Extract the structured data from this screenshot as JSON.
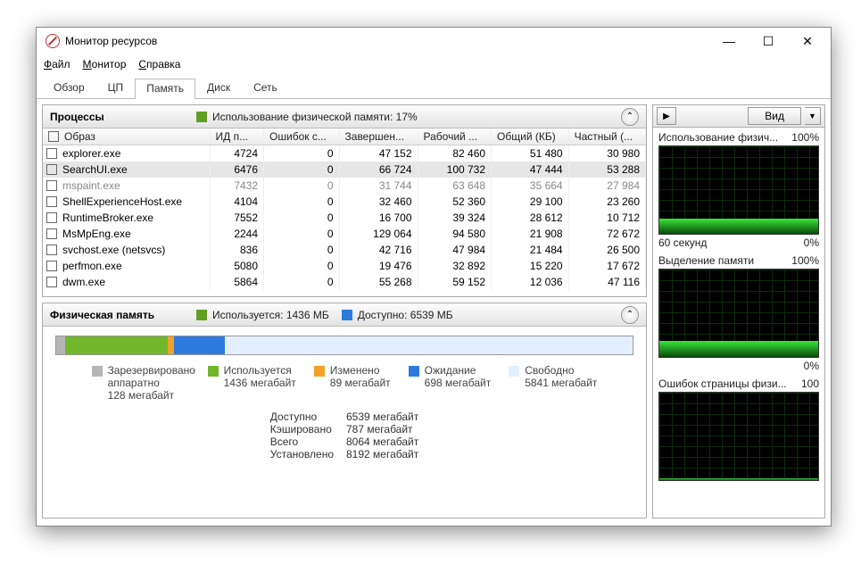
{
  "window": {
    "title": "Монитор ресурсов"
  },
  "menu": {
    "file": "Файл",
    "monitor": "Монитор",
    "help": "Справка"
  },
  "tabs": {
    "overview": "Обзор",
    "cpu": "ЦП",
    "memory": "Память",
    "disk": "Диск",
    "network": "Сеть"
  },
  "processes": {
    "title": "Процессы",
    "usage_label": "Использование физической памяти: 17%",
    "columns": {
      "image": "Образ",
      "pid": "ИД п...",
      "faults": "Ошибок с...",
      "commit": "Завершен...",
      "working": "Рабочий ...",
      "shared": "Общий (КБ)",
      "private": "Частный (..."
    },
    "rows": [
      {
        "name": "explorer.exe",
        "pid": "4724",
        "faults": "0",
        "commit": "47 152",
        "working": "82 460",
        "shared": "51 480",
        "private": "30 980"
      },
      {
        "name": "SearchUI.exe",
        "pid": "6476",
        "faults": "0",
        "commit": "66 724",
        "working": "100 732",
        "shared": "47 444",
        "private": "53 288",
        "selected": true
      },
      {
        "name": "mspaint.exe",
        "pid": "7432",
        "faults": "0",
        "commit": "31 744",
        "working": "63 648",
        "shared": "35 664",
        "private": "27 984",
        "dimmed": true
      },
      {
        "name": "ShellExperienceHost.exe",
        "pid": "4104",
        "faults": "0",
        "commit": "32 460",
        "working": "52 360",
        "shared": "29 100",
        "private": "23 260"
      },
      {
        "name": "RuntimeBroker.exe",
        "pid": "7552",
        "faults": "0",
        "commit": "16 700",
        "working": "39 324",
        "shared": "28 612",
        "private": "10 712"
      },
      {
        "name": "MsMpEng.exe",
        "pid": "2244",
        "faults": "0",
        "commit": "129 064",
        "working": "94 580",
        "shared": "21 908",
        "private": "72 672"
      },
      {
        "name": "svchost.exe (netsvcs)",
        "pid": "836",
        "faults": "0",
        "commit": "42 716",
        "working": "47 984",
        "shared": "21 484",
        "private": "26 500"
      },
      {
        "name": "perfmon.exe",
        "pid": "5080",
        "faults": "0",
        "commit": "19 476",
        "working": "32 892",
        "shared": "15 220",
        "private": "17 672"
      },
      {
        "name": "dwm.exe",
        "pid": "5864",
        "faults": "0",
        "commit": "55 268",
        "working": "59 152",
        "shared": "12 036",
        "private": "47 116"
      }
    ]
  },
  "physmem": {
    "title": "Физическая память",
    "used_label": "Используется: 1436 МБ",
    "avail_label": "Доступно: 6539 МБ",
    "legend": {
      "hw": {
        "t": "Зарезервировано аппаратно",
        "v": "128 мегабайт"
      },
      "used": {
        "t": "Используется",
        "v": "1436 мегабайт"
      },
      "mod": {
        "t": "Изменено",
        "v": "89 мегабайт"
      },
      "stand": {
        "t": "Ожидание",
        "v": "698 мегабайт"
      },
      "free": {
        "t": "Свободно",
        "v": "5841 мегабайт"
      }
    },
    "stats": {
      "l1": "Доступно",
      "v1": "6539 мегабайт",
      "l2": "Кэшировано",
      "v2": "787 мегабайт",
      "l3": "Всего",
      "v3": "8064 мегабайт",
      "l4": "Установлено",
      "v4": "8192 мегабайт"
    }
  },
  "right": {
    "viewbtn": "Вид",
    "chart1": {
      "title": "Использование физич...",
      "max": "100%",
      "xlabel": "60 секунд",
      "min": "0%",
      "fill": 17
    },
    "chart2": {
      "title": "Выделение памяти",
      "max": "100%",
      "min": "0%",
      "fill": 18
    },
    "chart3": {
      "title": "Ошибок страницы физи...",
      "max": "100",
      "fill": 2
    }
  }
}
